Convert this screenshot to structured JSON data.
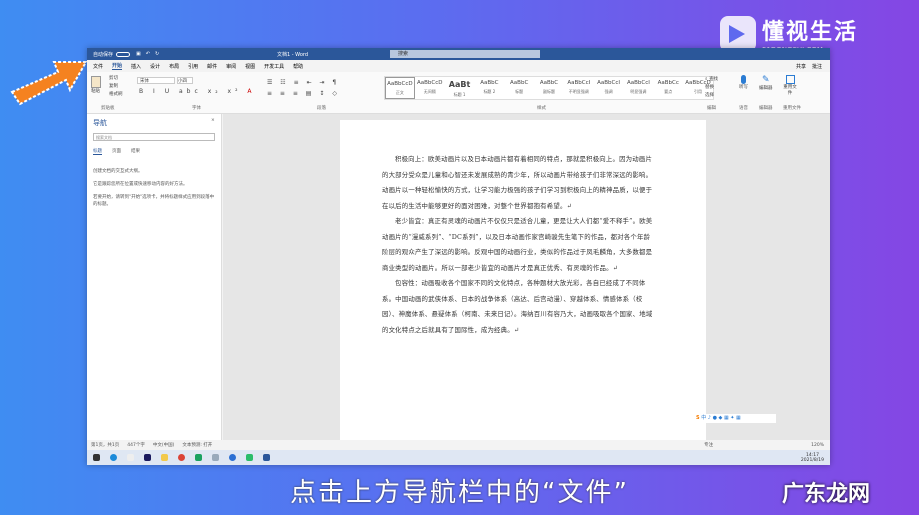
{
  "window": {
    "autosave": "自动保存",
    "title": "文档1 - Word",
    "search": "搜索"
  },
  "tabs": [
    "文件",
    "开始",
    "插入",
    "设计",
    "布局",
    "引用",
    "邮件",
    "审阅",
    "视图",
    "开发工具",
    "帮助"
  ],
  "tabs_right": [
    "共享",
    "批注"
  ],
  "ribbon": {
    "clipboard": {
      "paste": "粘贴",
      "cut": "剪切",
      "copy": "复制",
      "format_painter": "格式刷",
      "label": "剪贴板"
    },
    "font": {
      "name": "宋体",
      "size": "小四",
      "label": "字体"
    },
    "paragraph": {
      "label": "段落"
    },
    "styles": {
      "items": [
        {
          "sample": "AaBbCcD",
          "name": "正文"
        },
        {
          "sample": "AaBbCcD",
          "name": "无间隔"
        },
        {
          "sample": "AaBt",
          "name": "标题 1"
        },
        {
          "sample": "AaBbC",
          "name": "标题 2"
        },
        {
          "sample": "AaBbC",
          "name": "标题"
        },
        {
          "sample": "AaBbC",
          "name": "副标题"
        },
        {
          "sample": "AaBbCcI",
          "name": "不明显强调"
        },
        {
          "sample": "AaBbCcI",
          "name": "强调"
        },
        {
          "sample": "AaBbCcI",
          "name": "明显强调"
        },
        {
          "sample": "AaBbCc",
          "name": "要点"
        },
        {
          "sample": "AaBbCcD",
          "name": "引用"
        }
      ],
      "label": "样式"
    },
    "editing": {
      "find": "查找",
      "replace": "替换",
      "select": "选择",
      "label": "编辑"
    },
    "voice": {
      "dictate": "听写",
      "label": "语音"
    },
    "editor": {
      "name": "编辑器",
      "label": "编辑器"
    },
    "reuse": {
      "name": "重用文件",
      "label": "重用文件"
    }
  },
  "nav": {
    "title": "导航",
    "search_placeholder": "搜索文档",
    "tabs": [
      "标题",
      "页面",
      "结果"
    ],
    "hints": [
      "创建文档的交互式大纲。",
      "它是跟踪您所在位置或快速移动内容的好方法。",
      "若要开始，请转到\"开始\"选项卡，并将标题样式应用到段落中的标题。"
    ]
  },
  "document": {
    "paragraphs": [
      "积极向上：欧美动画片以及日本动画片都有着相同的特点，那就是积极向上。因为动画片的大部分受众是儿童和心智还未发展成熟的青少年，所以动画片带给孩子们非常深远的影响。动画片以一种轻松愉快的方式，让学习能力极强的孩子们学习到积极向上的精神品质，以便于在以后的生活中能够更好的面对困难，对整个世界都抱有希望。↵",
      "老少皆宜：真正有灵魂的动画片不仅仅只是适合儿童，更是让大人们都“爱不释手”。欧美动画片的“漫威系列”、“DC系列”，以及日本动画作家宫崎骏先生笔下的作品，都对各个年龄阶层的观众产生了深远的影响。反观中国的动画行业，类似的作品过于凤毛麟角，大多数都是商业类型的动画片。所以一部老少皆宜的动画片才是真正优秀、有灵魂的作品。↵",
      "包容性：动画吸收各个国家不同的文化特点，各种题材大放光彩，各自已经成了不同体系。中国动画的武侠体系、日本的战争体系（高达、后宫动漫）、穿越体系、情感体系（校园）、神魔体系、悬疑体系（柯南、未来日记）。海纳百川有容乃大，动画吸取各个国家、地域的文化特点之后就具有了国际性，成为经典。↵"
    ]
  },
  "status": {
    "page": "第1页，共1页",
    "words": "447个字",
    "lang": "中文(中国)",
    "accessibility": "文本预测: 打开",
    "focus": "专注",
    "zoom": "120%"
  },
  "clock": {
    "time": "14:17",
    "date": "2021/8/19"
  },
  "caption": "点击上方导航栏中的“文件”",
  "watermark": {
    "brand": "懂视生活",
    "domain": "51DONGSHI.COM",
    "corner": "广东龙网"
  }
}
